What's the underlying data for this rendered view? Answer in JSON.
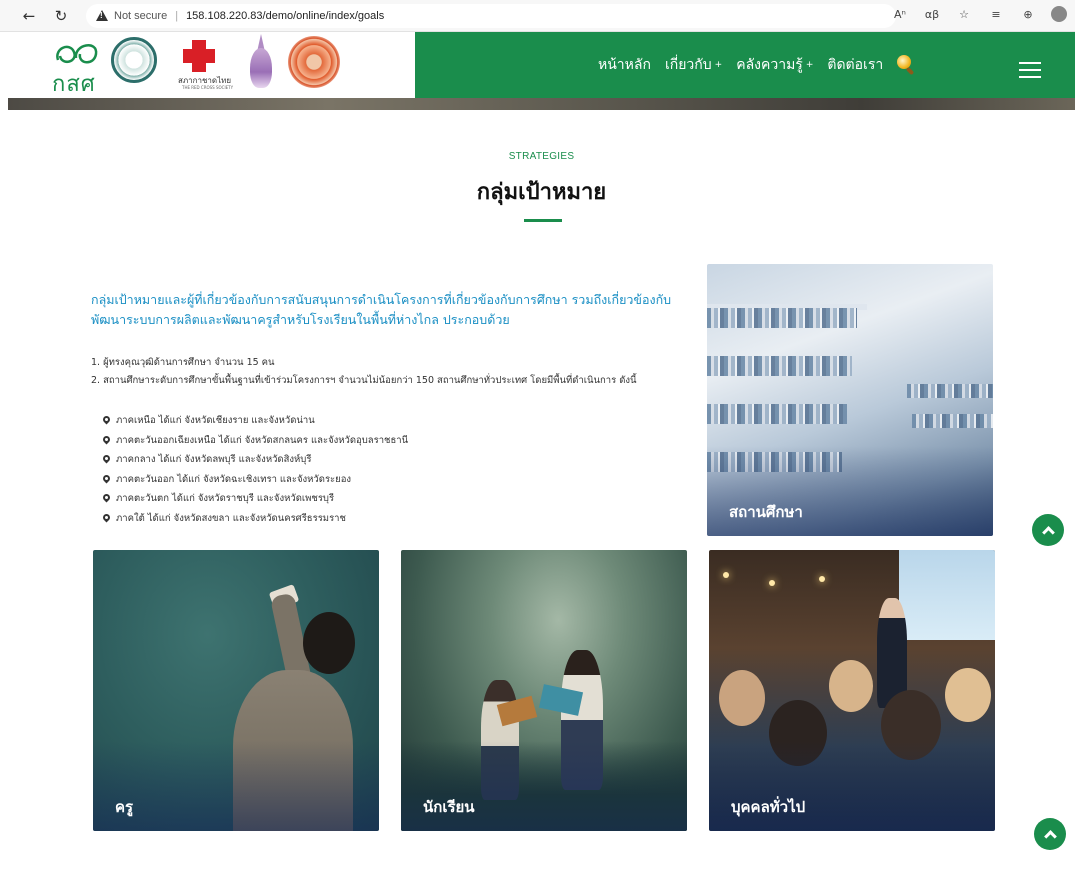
{
  "browser": {
    "security_label": "Not secure",
    "url": "158.108.220.83/demo/online/index/goals"
  },
  "header": {
    "logo_text": "กสศ",
    "redcross_text": "สภากาชาดไทย",
    "redcross_sub": "THE RED CROSS SOCIETY",
    "menu": [
      {
        "label": "หน้าหลัก",
        "has_submenu": false
      },
      {
        "label": "เกี่ยวกับ",
        "has_submenu": true
      },
      {
        "label": "คลังความรู้",
        "has_submenu": true
      },
      {
        "label": "ติดต่อเรา",
        "has_submenu": false
      }
    ],
    "accent_color": "#1a8d4c"
  },
  "page": {
    "eyebrow": "STRATEGIES",
    "title": "กลุ่มเป้าหมาย",
    "intro": "กลุ่มเป้าหมายและผู้ที่เกี่ยวข้องกับการสนับสนุนการดำเนินโครงการที่เกี่ยวข้องกับการศึกษา รวมถึงเกี่ยวข้องกับพัฒนาระบบการผลิตและพัฒนาครูสำหรับโรงเรียนในพื้นที่ห่างไกล ประกอบด้วย",
    "numbered": [
      "1. ผู้ทรงคุณวุฒิด้านการศึกษา จำนวน 15 คน",
      "2. สถานศึกษาระดับการศึกษาขั้นพื้นฐานที่เข้าร่วมโครงการฯ จำนวนไม่น้อยกว่า 150 สถานศึกษาทั่วประเทศ โดยมีพื้นที่ดำเนินการ ดังนี้"
    ],
    "regions": [
      "ภาคเหนือ ได้แก่ จังหวัดเชียงราย และจังหวัดน่าน",
      "ภาคตะวันออกเฉียงเหนือ ได้แก่ จังหวัดสกลนคร และจังหวัดอุบลราชธานี",
      "ภาคกลาง ได้แก่ จังหวัดลพบุรี และจังหวัดสิงห์บุรี",
      "ภาคตะวันออก ได้แก่ จังหวัดฉะเชิงเทรา และจังหวัดระยอง",
      "ภาคตะวันตก ได้แก่ จังหวัดราชบุรี และจังหวัดเพชรบุรี",
      "ภาคใต้ ได้แก่ จังหวัดสงขลา และจังหวัดนครศรีธรรมราช"
    ]
  },
  "cards": {
    "school": "สถานศึกษา",
    "teacher": "ครู",
    "students": "นักเรียน",
    "public": "บุคคลทั่วไป"
  }
}
